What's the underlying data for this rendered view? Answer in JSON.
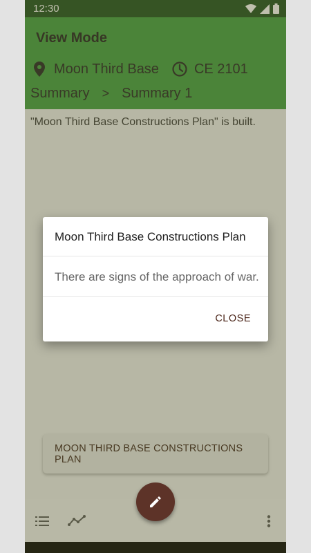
{
  "status_bar": {
    "time": "12:30"
  },
  "appbar": {
    "title": "View Mode",
    "location": "Moon Third Base",
    "date": "CE 2101",
    "breadcrumb": [
      "Summary",
      "Summary 1"
    ],
    "breadcrumb_separator": ">"
  },
  "content": {
    "text": "\"Moon Third Base Constructions Plan\" is built."
  },
  "dialog": {
    "title": "Moon Third Base Constructions Plan",
    "message": "There are signs of the approach of war.",
    "close_label": "CLOSE"
  },
  "snackbar": {
    "text": "MOON THIRD BASE CONSTRUCTIONS PLAN"
  },
  "bottom_bar": {
    "icons": [
      "list-icon",
      "timeline-icon",
      "more-vert-icon"
    ]
  },
  "fab": {
    "icon": "edit-icon"
  },
  "colors": {
    "appbar": "#3f9d3f",
    "status_bar": "#1b4d1b",
    "accent": "#5d3328"
  }
}
